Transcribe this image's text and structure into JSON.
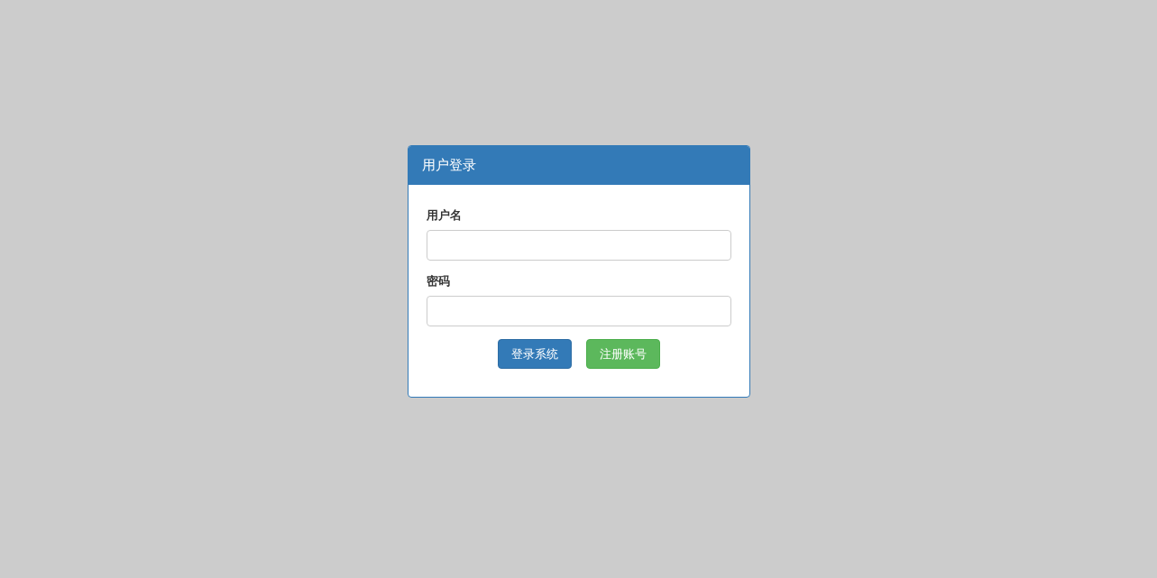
{
  "panel": {
    "title": "用户登录"
  },
  "fields": [
    {
      "label": "用户名"
    },
    {
      "label": "密码"
    }
  ],
  "buttons": [
    {
      "label": "登录系统",
      "kind": "primary"
    },
    {
      "label": "注册账号",
      "kind": "success"
    }
  ]
}
